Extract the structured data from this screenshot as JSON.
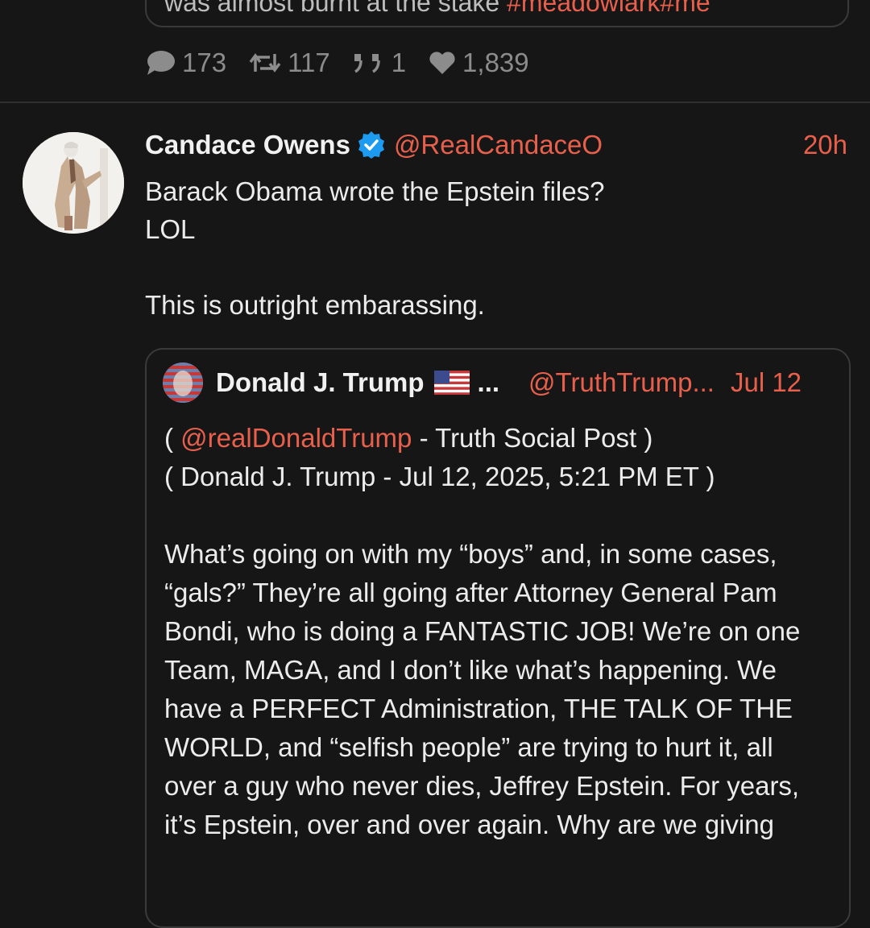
{
  "previous_post": {
    "cut_text": "was almost burnt at the stake",
    "cut_link": "#meadowlark#me"
  },
  "stats": {
    "replies": "173",
    "reposts": "117",
    "quotes": "1",
    "likes": "1,839"
  },
  "post": {
    "author_name": "Candace Owens",
    "author_handle": "@RealCandaceO",
    "time": "20h",
    "body": "Barack Obama wrote the Epstein files?\nLOL\n\nThis is outright embarassing."
  },
  "quoted_post": {
    "author_name": "Donald J. Trump",
    "ellipsis": "...",
    "author_handle": "@TruthTrump...",
    "time": "Jul 12",
    "line1_open": "( ",
    "line1_link": "@realDonaldTrump",
    "line1_rest": " - Truth Social Post )",
    "line2": "( Donald J. Trump - Jul 12, 2025, 5:21 PM ET )",
    "body": "What’s going on with my “boys” and, in some cases, “gals?” They’re all going after Attorney General Pam Bondi, who is doing a FANTASTIC JOB! We’re on one Team, MAGA, and I don’t like what’s happening. We have a PERFECT Administration, THE TALK OF THE WORLD, and “selfish people” are trying to hurt it, all over a guy who never dies, Jeffrey Epstein. For years, it’s Epstein, over and over again. Why are we giving"
  },
  "colors": {
    "background": "#161616",
    "accent": "#e8604c",
    "muted": "#8c8c8c",
    "verified": "#1d9bf0"
  }
}
